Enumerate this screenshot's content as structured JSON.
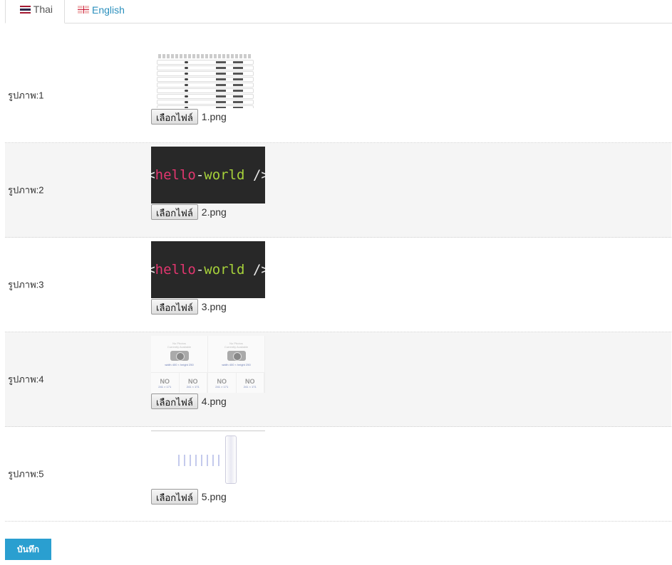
{
  "tabs": [
    {
      "label": "Thai",
      "flag": "thai-flag-icon",
      "active": true
    },
    {
      "label": "English",
      "flag": "uk-flag-icon",
      "active": false
    }
  ],
  "rows": [
    {
      "label": "รูปภาพ:1",
      "button": "เลือกไฟล์",
      "filename": "1.png",
      "thumb": "table-screenshot"
    },
    {
      "label": "รูปภาพ:2",
      "button": "เลือกไฟล์",
      "filename": "2.png",
      "thumb": "hello-world-code",
      "code": {
        "open": "<",
        "word1": "hello",
        "dash": "-",
        "word2": "world",
        "close": " />"
      }
    },
    {
      "label": "รูปภาพ:3",
      "button": "เลือกไฟล์",
      "filename": "3.png",
      "thumb": "hello-world-code",
      "code": {
        "open": "<",
        "word1": "hello",
        "dash": "-",
        "word2": "world",
        "close": " />"
      }
    },
    {
      "label": "รูปภาพ:4",
      "button": "เลือกไฟล์",
      "filename": "4.png",
      "thumb": "no-photo-placeholder",
      "np": {
        "line1": "No Photos",
        "line2": "Currently Available",
        "size": "width 400 × height 250",
        "no": "NO",
        "dims": "241 × 171"
      }
    },
    {
      "label": "รูปภาพ:5",
      "button": "เลือกไฟล์",
      "filename": "5.png",
      "thumb": "faded-screenshot"
    }
  ],
  "save_label": "บันทึก",
  "colors": {
    "accent": "#2a9fd0",
    "link": "#2a8fbd",
    "code_bg": "#282828",
    "code_pink": "#e2366f",
    "code_green": "#a6d13a"
  }
}
